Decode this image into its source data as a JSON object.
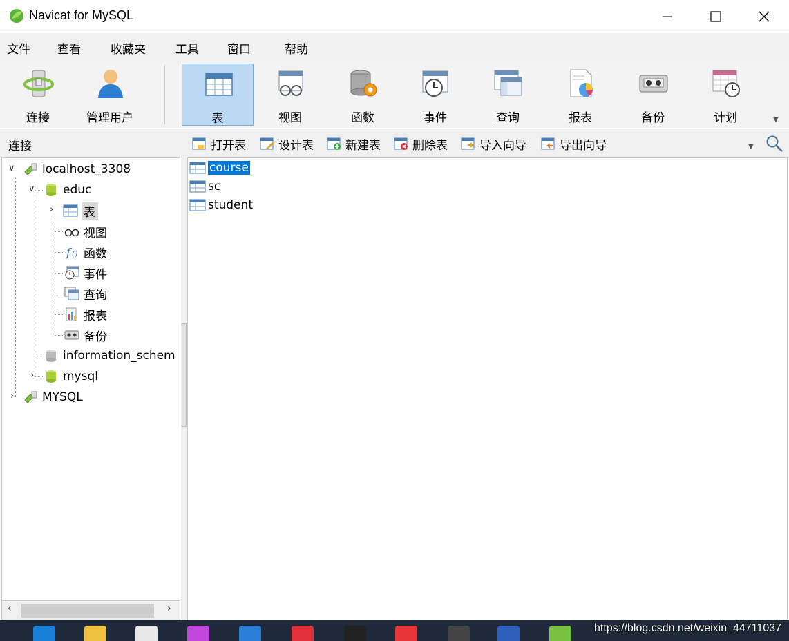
{
  "window": {
    "title": "Navicat for MySQL",
    "app_icon": "navicat-leaf-icon"
  },
  "menu": [
    "文件",
    "查看",
    "收藏夹",
    "工具",
    "窗口",
    "帮助"
  ],
  "toolbar": {
    "buttons": [
      {
        "label": "连接",
        "icon": "connection-icon"
      },
      {
        "label": "管理用户",
        "icon": "user-icon"
      },
      {
        "label": "表",
        "icon": "table-icon"
      },
      {
        "label": "视图",
        "icon": "view-icon"
      },
      {
        "label": "函数",
        "icon": "function-icon"
      },
      {
        "label": "事件",
        "icon": "event-icon"
      },
      {
        "label": "查询",
        "icon": "query-icon"
      },
      {
        "label": "报表",
        "icon": "report-icon"
      },
      {
        "label": "备份",
        "icon": "backup-icon"
      },
      {
        "label": "计划",
        "icon": "schedule-icon"
      }
    ],
    "active": "表"
  },
  "left_header": "连接",
  "object_toolbar": [
    "打开表",
    "设计表",
    "新建表",
    "删除表",
    "导入向导",
    "导出向导"
  ],
  "tree": {
    "connection1": "localhost_3308",
    "db_educ": "educ",
    "educ_children": [
      "表",
      "视图",
      "函数",
      "事件",
      "查询",
      "报表",
      "备份"
    ],
    "db_info": "information_schem",
    "db_mysql": "mysql",
    "connection2": "MYSQL"
  },
  "tables": [
    "course",
    "sc",
    "student"
  ],
  "selected_table": "course",
  "watermark": "https://blog.csdn.net/weixin_44711037",
  "colors": {
    "selection": "#0078d7",
    "active_tool": "#bcd9f3",
    "taskbar": "#1e2a3a"
  }
}
